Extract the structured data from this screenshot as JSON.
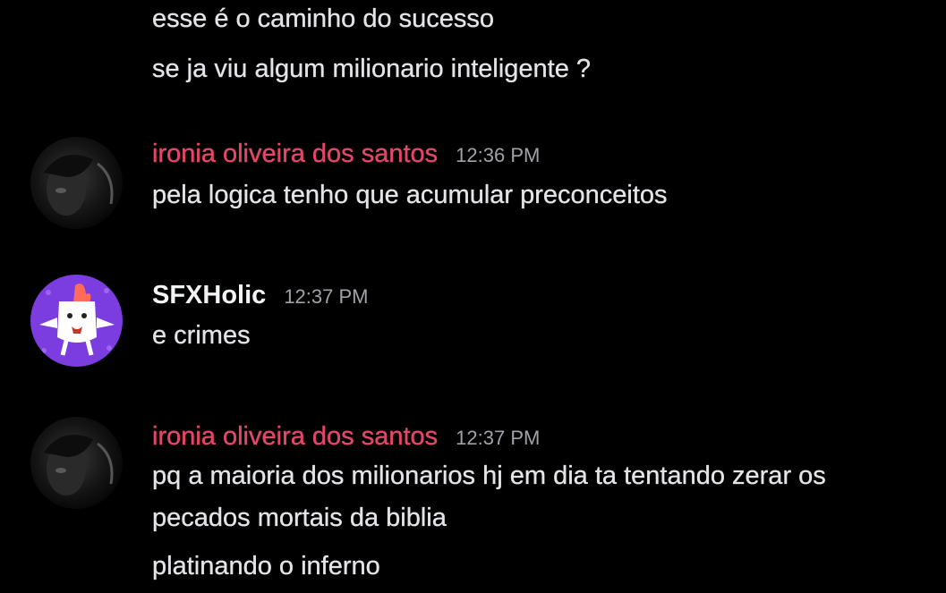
{
  "colors": {
    "background": "#000000",
    "message_text": "#e3e4e8",
    "author_pink": "#e14766",
    "author_white": "#f2f3f5",
    "timestamp": "#a0a2a8",
    "sfx_avatar_bg": "#7b3ce0"
  },
  "messages": [
    {
      "text": "esse é o caminho do sucesso"
    },
    {
      "text": "se ja viu algum milionario inteligente ?"
    }
  ],
  "groups": [
    {
      "author": "ironia oliveira dos santos",
      "timestamp": "12:36 PM",
      "avatar_icon": "dark-anime-character-avatar-icon",
      "lines": [
        "pela logica tenho que acumular preconceitos"
      ]
    },
    {
      "author": "SFXHolic",
      "timestamp": "12:37 PM",
      "avatar_icon": "cartoon-character-avatar-icon",
      "lines": [
        "e crimes"
      ]
    },
    {
      "author": "ironia oliveira dos santos",
      "timestamp": "12:37 PM",
      "avatar_icon": "dark-anime-character-avatar-icon",
      "lines": [
        "pq a maioria dos milionarios hj em dia ta tentando zerar os",
        "pecados mortais da biblia",
        "platinando o inferno"
      ]
    }
  ]
}
